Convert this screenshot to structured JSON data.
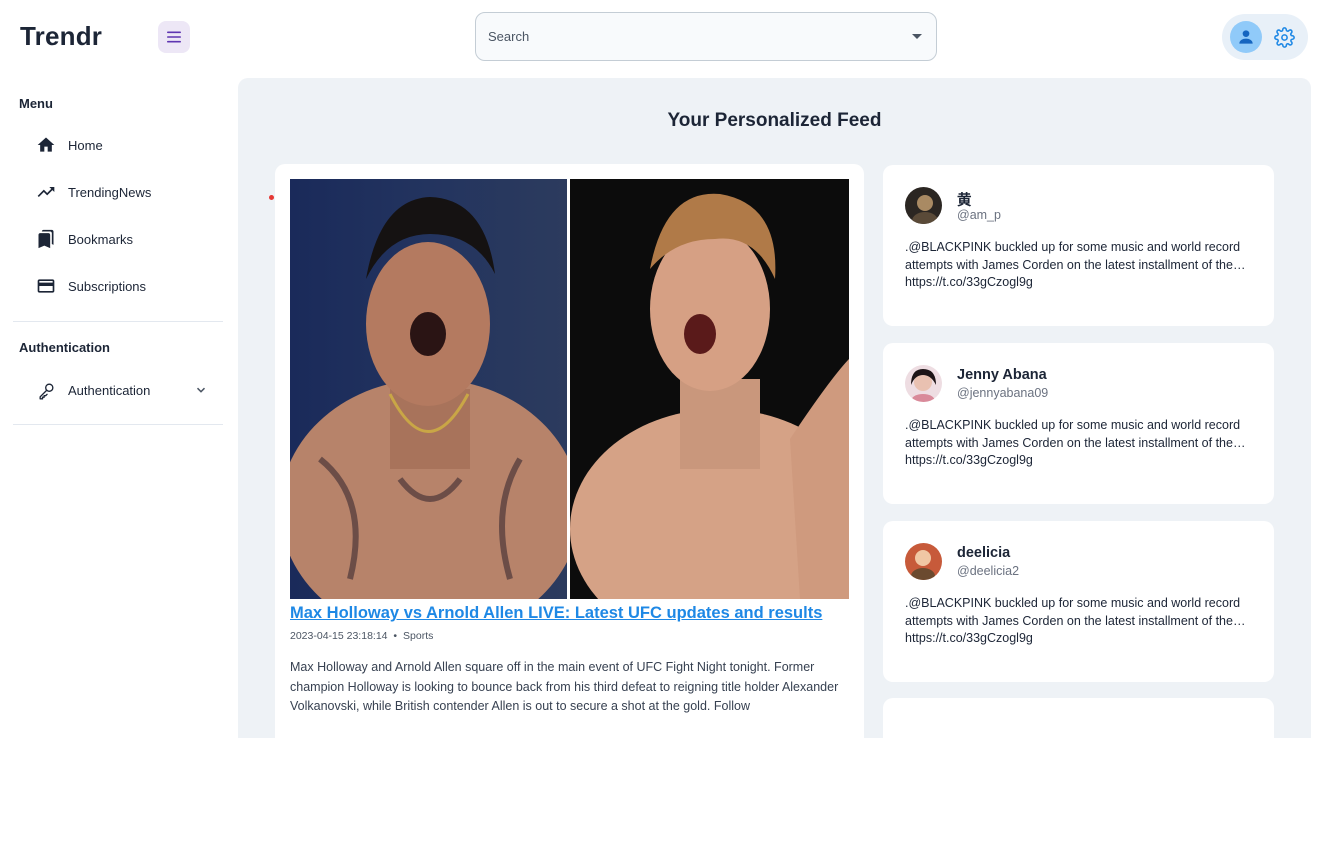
{
  "app": {
    "brand": "Trendr"
  },
  "header": {
    "search": {
      "placeholder": "Search"
    }
  },
  "sidebar": {
    "menu_title": "Menu",
    "items": [
      {
        "label": "Home",
        "icon": "home-icon"
      },
      {
        "label": "TrendingNews",
        "icon": "trending-up-icon"
      },
      {
        "label": "Bookmarks",
        "icon": "bookmarks-icon"
      },
      {
        "label": "Subscriptions",
        "icon": "credit-card-icon"
      }
    ],
    "auth_title": "Authentication",
    "auth_item": {
      "label": "Authentication",
      "icon": "key-icon"
    }
  },
  "main": {
    "title": "Your Personalized Feed",
    "article": {
      "title": "Max Holloway vs Arnold Allen LIVE: Latest UFC updates and results",
      "date": "2023-04-15 23:18:14",
      "separator": "•",
      "category": "Sports",
      "body": "Max Holloway and Arnold Allen square off in the main event of UFC Fight Night tonight. Former champion Holloway is looking to bounce back from his third defeat to reigning title holder Alexander Volkanovski, while British contender Allen is out to secure a shot at the gold. Follow"
    },
    "tweets": [
      {
        "name": "黄",
        "handle": "@am_p",
        "text": ".@BLACKPINK buckled up for some music and world record attempts with James Corden on the latest installment of the… https://t.co/33gCzogl9g"
      },
      {
        "name": "Jenny Abana",
        "handle": "@jennyabana09",
        "text": ".@BLACKPINK buckled up for some music and world record attempts with James Corden on the latest installment of the… https://t.co/33gCzogl9g"
      },
      {
        "name": "deelicia",
        "handle": "@deelicia2",
        "text": ".@BLACKPINK buckled up for some music and world record attempts with James Corden on the latest installment of the… https://t.co/33gCzogl9g"
      }
    ]
  },
  "colors": {
    "accent": "#1e88e5",
    "menu_button_bg": "#ede7f6",
    "main_bg": "#eef2f6",
    "avatar_bg": "#90caf9"
  }
}
